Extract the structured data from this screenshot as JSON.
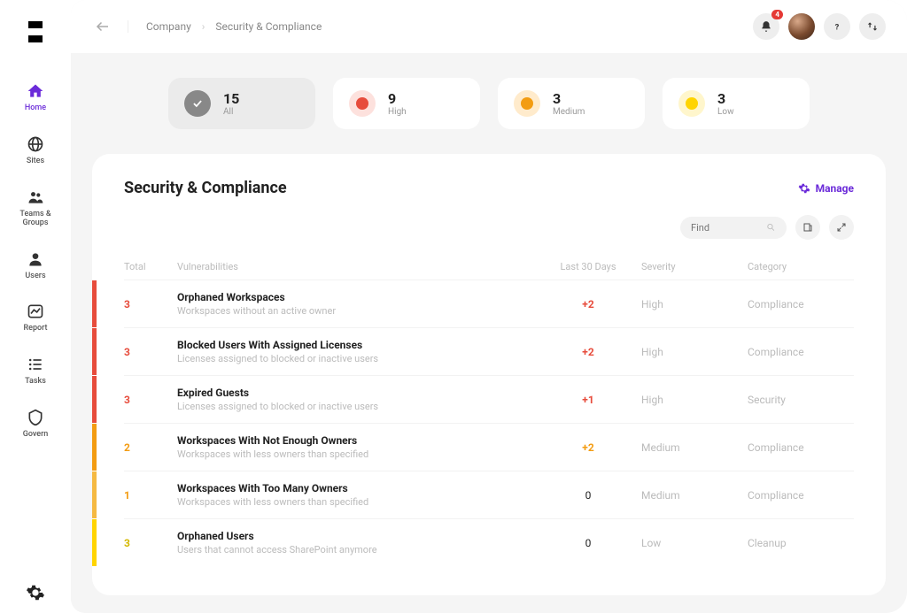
{
  "breadcrumbs": {
    "root": "Company",
    "current": "Security & Compliance"
  },
  "notifications": {
    "count": "4"
  },
  "sidebar": {
    "items": [
      {
        "label": "Home"
      },
      {
        "label": "Sites"
      },
      {
        "label": "Teams & Groups"
      },
      {
        "label": "Users"
      },
      {
        "label": "Report"
      },
      {
        "label": "Tasks"
      },
      {
        "label": "Govern"
      }
    ]
  },
  "stats": [
    {
      "count": "15",
      "label": "All"
    },
    {
      "count": "9",
      "label": "High"
    },
    {
      "count": "3",
      "label": "Medium"
    },
    {
      "count": "3",
      "label": "Low"
    }
  ],
  "panel": {
    "title": "Security & Compliance",
    "manage_label": "Manage",
    "find_placeholder": "Find"
  },
  "columns": {
    "total": "Total",
    "vuln": "Vulnerabilities",
    "last30": "Last 30 Days",
    "severity": "Severity",
    "category": "Category"
  },
  "rows": [
    {
      "total": "3",
      "sev_class": "high",
      "title": "Orphaned Workspaces",
      "desc": "Workspaces without an active owner",
      "delta": "+2",
      "delta_class": "high",
      "severity": "High",
      "category": "Compliance"
    },
    {
      "total": "3",
      "sev_class": "high",
      "title": "Blocked Users With Assigned Licenses",
      "desc": "Licenses assigned to blocked or inactive users",
      "delta": "+2",
      "delta_class": "high",
      "severity": "High",
      "category": "Compliance"
    },
    {
      "total": "3",
      "sev_class": "high",
      "title": "Expired Guests",
      "desc": "Licenses assigned to blocked or inactive users",
      "delta": "+1",
      "delta_class": "high",
      "severity": "High",
      "category": "Security"
    },
    {
      "total": "2",
      "sev_class": "med",
      "title": "Workspaces With Not Enough Owners",
      "desc": "Workspaces with less owners than specified",
      "delta": "+2",
      "delta_class": "",
      "severity": "Medium",
      "category": "Compliance"
    },
    {
      "total": "1",
      "sev_class": "med2",
      "title": "Workspaces With Too Many Owners",
      "desc": "Workspaces with less owners than specified",
      "delta": "0",
      "delta_class": "zero",
      "severity": "Medium",
      "category": "Compliance"
    },
    {
      "total": "3",
      "sev_class": "low",
      "title": "Orphaned Users",
      "desc": "Users that cannot access SharePoint anymore",
      "delta": "0",
      "delta_class": "zero",
      "severity": "Low",
      "category": "Cleanup"
    }
  ]
}
